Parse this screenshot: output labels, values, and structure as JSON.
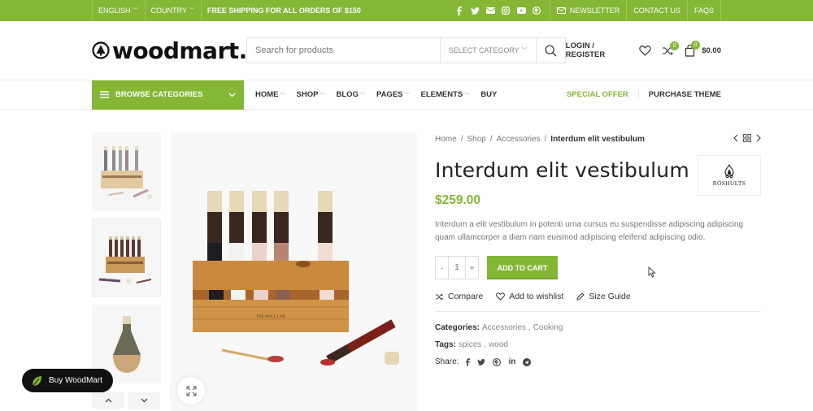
{
  "topbar": {
    "language": "ENGLISH",
    "country": "COUNTRY",
    "promo": "FREE SHIPPING FOR ALL ORDERS OF $150",
    "social_icons": [
      "facebook-icon",
      "twitter-icon",
      "mail-icon",
      "instagram-icon",
      "youtube-icon",
      "pinterest-icon"
    ],
    "newsletter": "NEWSLETTER",
    "contact": "CONTACT US",
    "faqs": "FAQS"
  },
  "header": {
    "logo_text": "woodmart.",
    "search_placeholder": "Search for products",
    "category_select": "SELECT CATEGORY",
    "login": "LOGIN / REGISTER",
    "compare_count": "0",
    "cart_count": "0",
    "cart_total": "$0.00"
  },
  "nav": {
    "browse": "BROWSE CATEGORIES",
    "menu": [
      {
        "label": "HOME",
        "dropdown": true
      },
      {
        "label": "SHOP",
        "dropdown": true
      },
      {
        "label": "BLOG",
        "dropdown": true
      },
      {
        "label": "PAGES",
        "dropdown": true
      },
      {
        "label": "ELEMENTS",
        "dropdown": true
      },
      {
        "label": "BUY",
        "dropdown": false
      }
    ],
    "special_offer": "SPECIAL OFFER",
    "purchase_theme": "PURCHASE THEME"
  },
  "product": {
    "breadcrumb": [
      "Home",
      "Shop",
      "Accessories",
      "Interdum elit vestibulum"
    ],
    "title": "Interdum elit vestibulum",
    "brand": "RÖSHULTS",
    "price": "$259.00",
    "description": "Interdum a elit vestibulum in potenti urna cursus eu suspendisse adipiscing adipiscing quam ullamcorper a diam nam euismod adipiscing eleifend adipiscing odio.",
    "quantity": "1",
    "qty_minus": "-",
    "qty_plus": "+",
    "add_to_cart": "ADD TO CART",
    "compare": "Compare",
    "wishlist": "Add to wishlist",
    "size_guide": "Size Guide",
    "categories_label": "Categories:",
    "categories": [
      "Accessories",
      "Cooking"
    ],
    "tags_label": "Tags:",
    "tags": [
      "spices",
      "wood"
    ],
    "share_label": "Share:",
    "share_icons": [
      "facebook-icon",
      "twitter-icon",
      "pinterest-icon",
      "linkedin-icon",
      "telegram-icon"
    ]
  },
  "floating": {
    "buy_woodmart": "Buy WoodMart"
  },
  "colors": {
    "accent": "#83b735",
    "dark": "#111111"
  }
}
